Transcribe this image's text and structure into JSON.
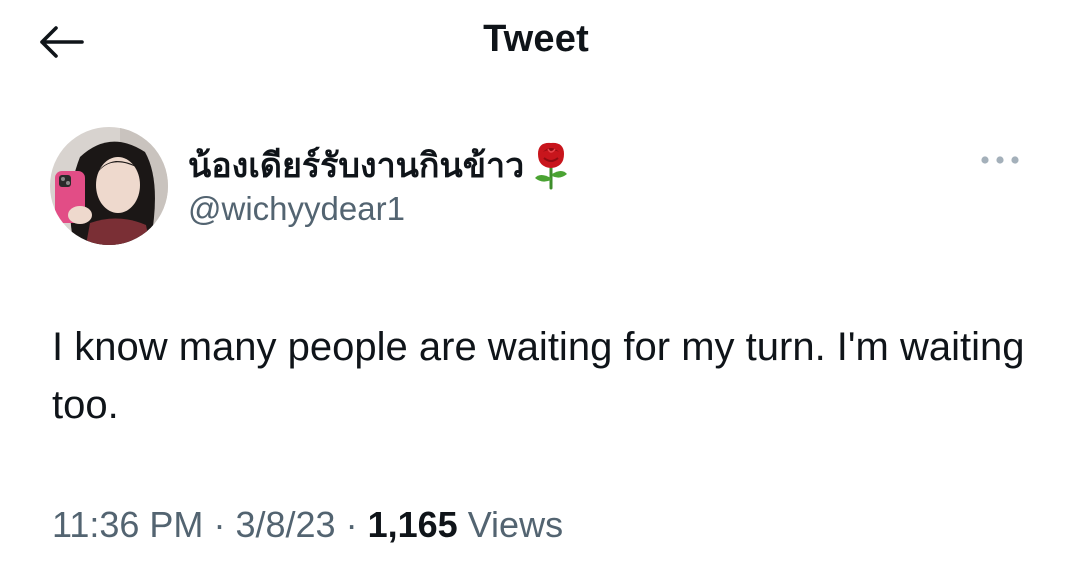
{
  "header": {
    "title": "Tweet",
    "back_icon": "arrow-left-icon"
  },
  "author": {
    "display_name": "น้องเดียร์รับงานกินข้าว",
    "name_emoji_icon": "rose-icon",
    "handle": "@wichyydear1",
    "avatar": "profile-photo"
  },
  "more_icon": "more-horizontal-icon",
  "tweet": {
    "text": "I know many people are waiting for my turn. I'm waiting too."
  },
  "meta": {
    "time": "11:36 PM",
    "separator": "·",
    "date": "3/8/23",
    "views_count": "1,165",
    "views_label": "Views"
  },
  "colors": {
    "text_primary": "#0f1419",
    "text_secondary": "#536471",
    "background": "#ffffff"
  }
}
